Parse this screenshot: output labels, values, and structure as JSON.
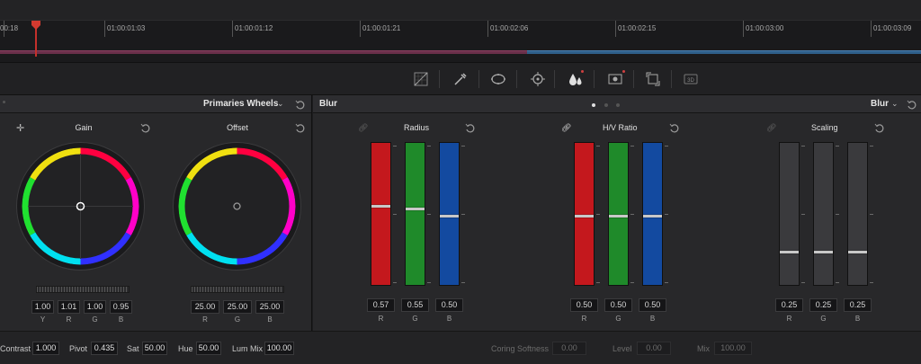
{
  "timeline": {
    "timecodes": [
      "00:18",
      "01:00:01:03",
      "01:00:01:12",
      "01:00:01:21",
      "01:00:02:06",
      "01:00:02:15",
      "01:00:03:00",
      "01:00:03:09"
    ]
  },
  "toolbar": {
    "tools": [
      "curves-icon",
      "qualifier-picker-icon",
      "window-icon",
      "tracker-icon",
      "blur-icon",
      "key-icon",
      "sizing-icon",
      "3d-icon"
    ]
  },
  "primaries": {
    "header_title": "Primaries Wheels",
    "wheels": [
      {
        "label": "Gain",
        "values": [
          "1.00",
          "1.01",
          "1.00",
          "0.95"
        ],
        "channels": [
          "Y",
          "R",
          "G",
          "B"
        ]
      },
      {
        "label": "Offset",
        "values": [
          "25.00",
          "25.00",
          "25.00"
        ],
        "channels": [
          "R",
          "G",
          "B"
        ]
      }
    ]
  },
  "blur": {
    "header_left": "Blur",
    "header_right": "Blur",
    "groups": [
      {
        "label": "Radius",
        "channels": [
          "R",
          "G",
          "B"
        ],
        "values": [
          "0.57",
          "0.55",
          "0.50"
        ],
        "levels": [
          0.57,
          0.55,
          0.5
        ]
      },
      {
        "label": "H/V Ratio",
        "channels": [
          "R",
          "G",
          "B"
        ],
        "values": [
          "0.50",
          "0.50",
          "0.50"
        ],
        "levels": [
          0.5,
          0.5,
          0.5
        ]
      },
      {
        "label": "Scaling",
        "channels": [
          "R",
          "G",
          "B"
        ],
        "values": [
          "0.25",
          "0.25",
          "0.25"
        ],
        "levels": [
          0.25,
          0.25,
          0.25
        ]
      }
    ]
  },
  "bottom": {
    "contrast_label": "Contrast",
    "contrast_value": "1.000",
    "pivot_label": "Pivot",
    "pivot_value": "0.435",
    "sat_label": "Sat",
    "sat_value": "50.00",
    "hue_label": "Hue",
    "hue_value": "50.00",
    "lummix_label": "Lum Mix",
    "lummix_value": "100.00",
    "coring_label": "Coring Softness",
    "coring_value": "0.00",
    "level_label": "Level",
    "level_value": "0.00",
    "mix_label": "Mix",
    "mix_value": "100.00"
  },
  "colors": {
    "red": "#c4181d",
    "green": "#1f8a2a",
    "blue": "#134aa0",
    "gray": "#3a3a3d",
    "playhead": "#c4302b"
  }
}
